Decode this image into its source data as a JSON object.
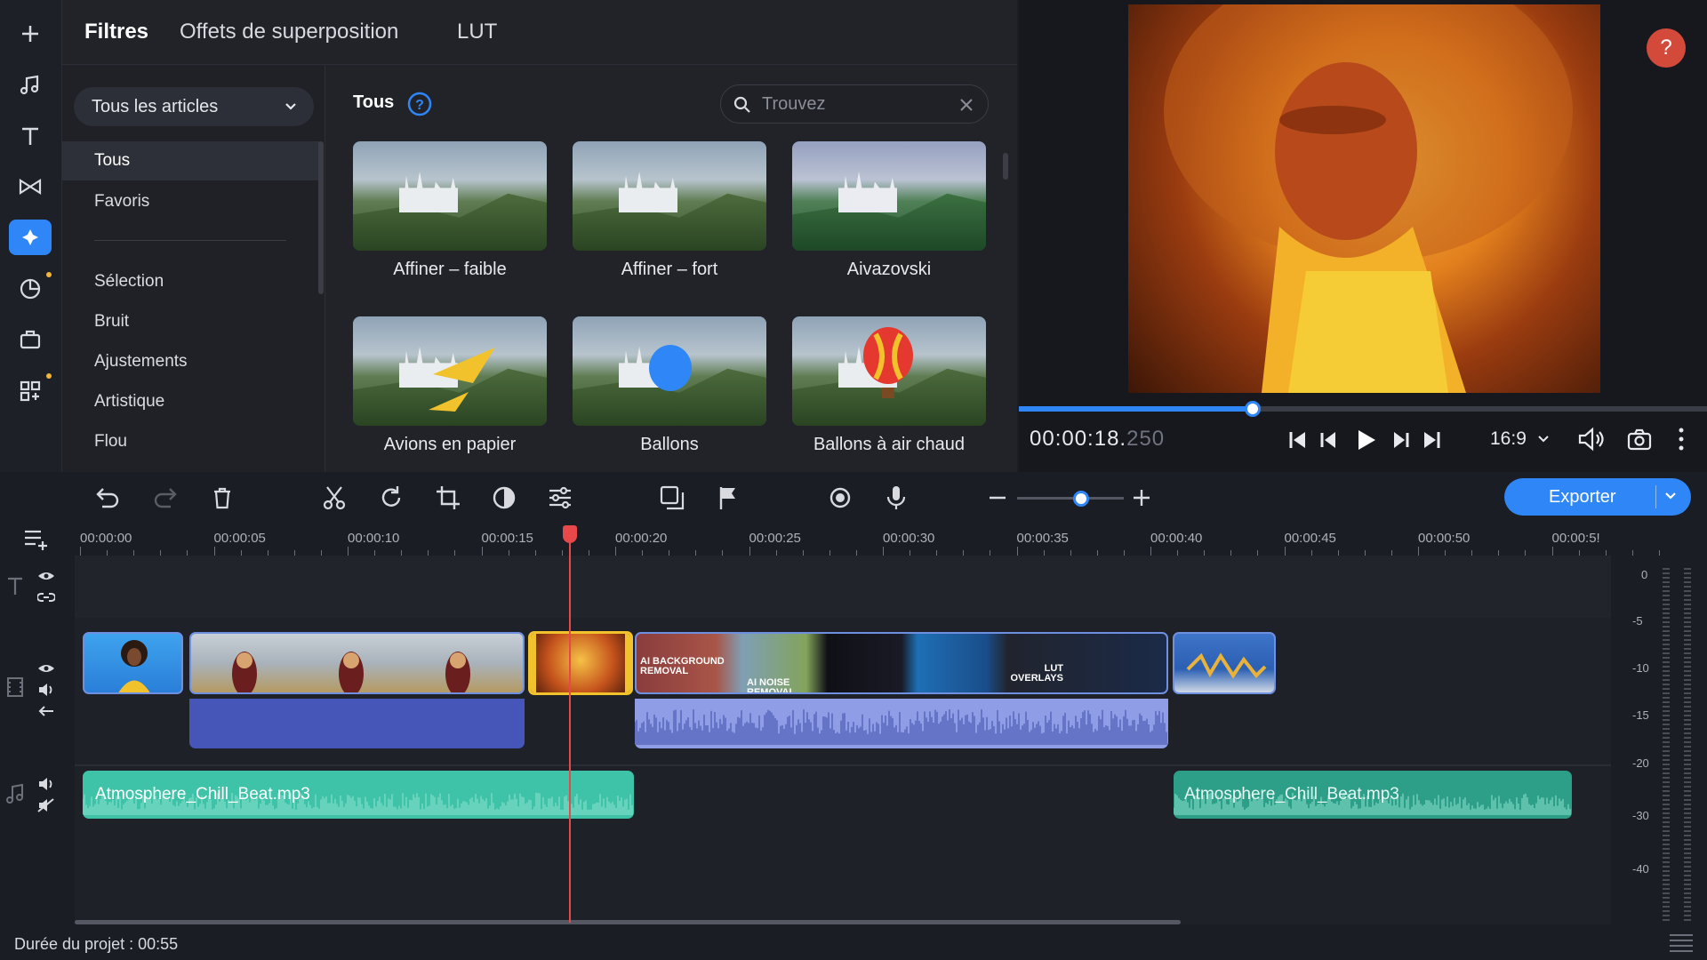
{
  "sidebar": {
    "icons": [
      "plus-icon",
      "music-note-icon",
      "text-icon",
      "transition-icon",
      "filters-icon",
      "sticker-icon",
      "stock-icon",
      "more-tools-icon"
    ]
  },
  "panel": {
    "tabs": [
      "Filtres",
      "Offets de superposition",
      "LUT"
    ],
    "dropdown_label": "Tous les articles",
    "categories": [
      "Tous",
      "Favoris",
      "Sélection",
      "Bruit",
      "Ajustements",
      "Artistique",
      "Flou"
    ],
    "section_title": "Tous",
    "search_placeholder": "Trouvez",
    "filters": [
      "Affiner – faible",
      "Affiner – fort",
      "Aivazovski",
      "Avions en papier",
      "Ballons",
      "Ballons à air chaud"
    ]
  },
  "preview": {
    "help": "?",
    "time_main": "00:00:18.",
    "time_ms": "250",
    "aspect": "16:9",
    "progress": 0.34
  },
  "toolbar": {
    "export_label": "Exporter",
    "zoom_level": 0.6
  },
  "timeline": {
    "ruler": [
      "00:00:00",
      "00:00:05",
      "00:00:10",
      "00:00:15",
      "00:00:20",
      "00:00:25",
      "00:00:30",
      "00:00:35",
      "00:00:40",
      "00:00:45",
      "00:00:50",
      "00:00:5!"
    ],
    "clip_texts": [
      "AI BACKGROUND REMOVAL",
      "AI NOISE REMOVAL",
      "LUT OVERLAYS"
    ],
    "audio_clips": [
      "Atmosphere_Chill_Beat.mp3",
      "Atmosphere_Chill_Beat.mp3"
    ],
    "vu_scale": [
      "0",
      "-5",
      "-10",
      "-15",
      "-20",
      "-30",
      "-40"
    ]
  },
  "status": {
    "duration": "Durée du projet : 00:55"
  },
  "colors": {
    "accent": "#2f86f6",
    "audio": "#3fc3a8",
    "selected_clip": "#f2c22c",
    "playhead": "#e8484a"
  }
}
